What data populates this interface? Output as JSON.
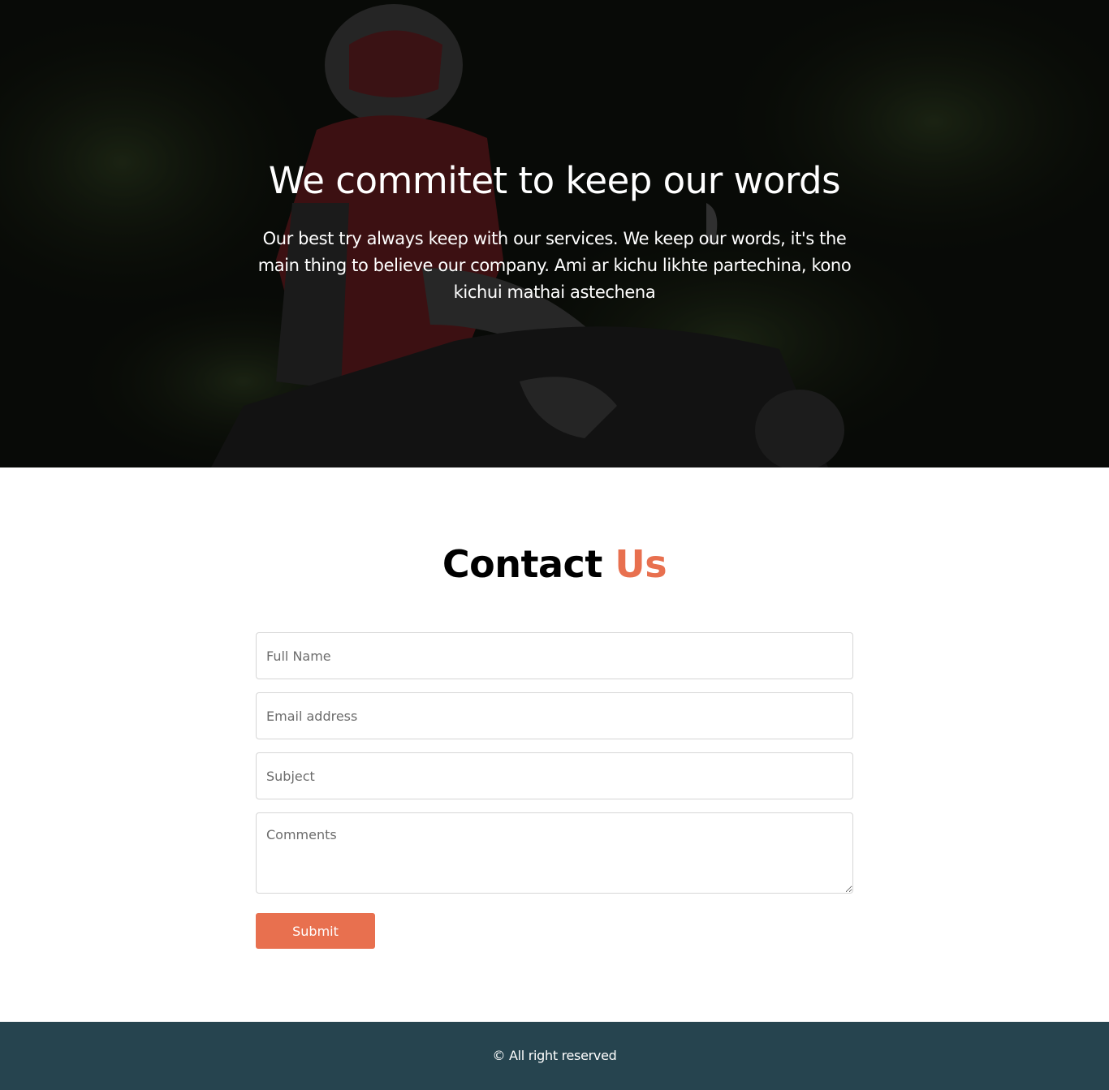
{
  "hero": {
    "title": "We commitet to keep our words",
    "text": "Our best try always keep with our services. We keep our words, it's the main thing to believe our company. Ami ar kichu likhte partechina, kono kichui mathai astechena"
  },
  "contact": {
    "title_main": "Contact",
    "title_accent": "Us",
    "accent_color": "#e8704f",
    "fields": {
      "full_name_placeholder": "Full Name",
      "email_placeholder": "Email address",
      "subject_placeholder": "Subject",
      "comments_placeholder": "Comments"
    },
    "submit_label": "Submit"
  },
  "footer": {
    "text": "© All right reserved",
    "background_color": "#26444f"
  }
}
